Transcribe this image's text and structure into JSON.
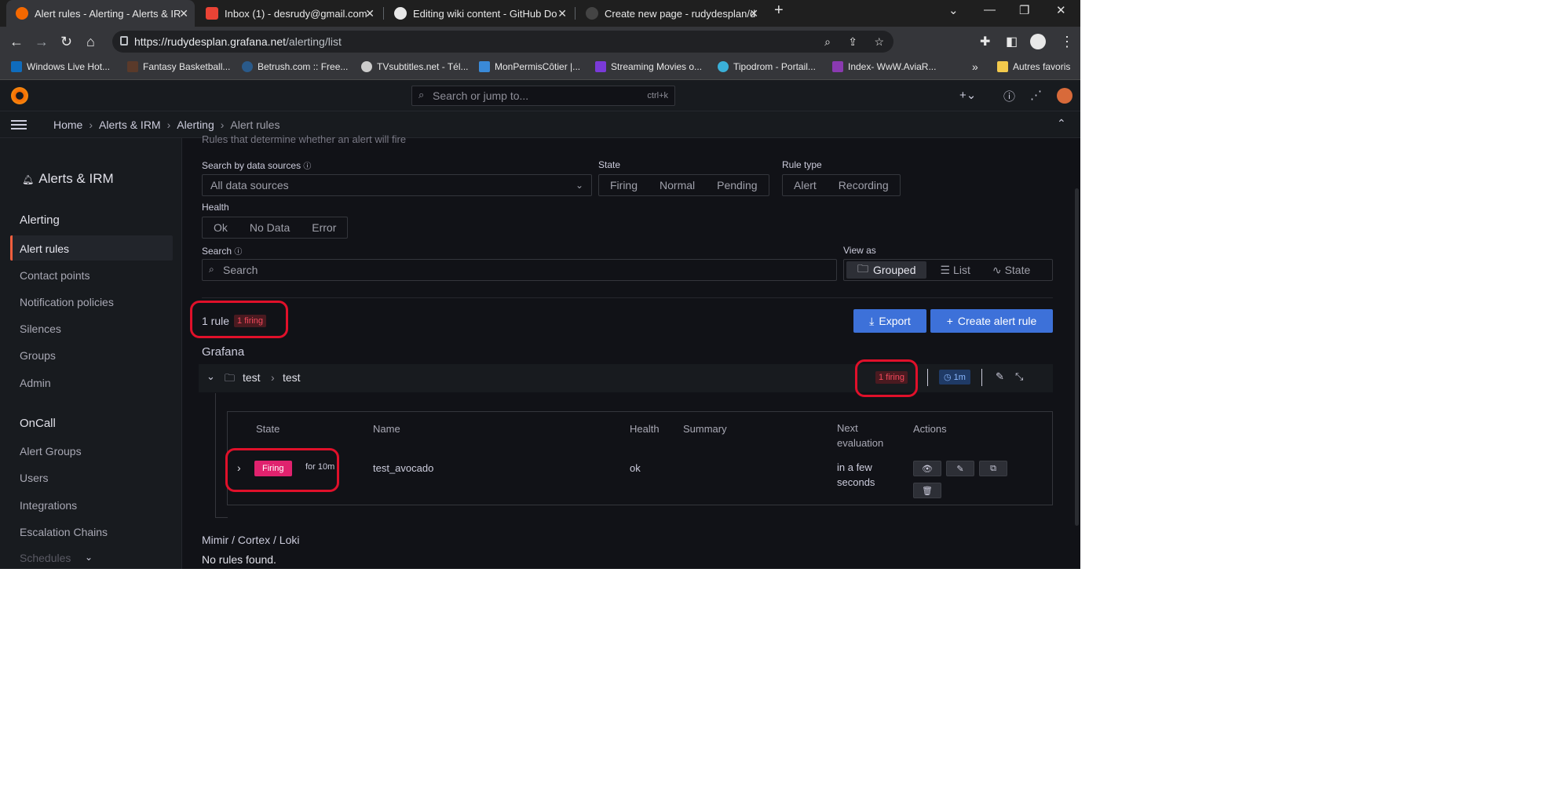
{
  "browser": {
    "tabs": [
      {
        "title": "Alert rules - Alerting - Alerts & IR",
        "active": true,
        "favicon_color": "#f46800"
      },
      {
        "title": "Inbox (1) - desrudy@gmail.com -",
        "active": false,
        "favicon_color": "#ea4335"
      },
      {
        "title": "Editing wiki content - GitHub Do",
        "active": false,
        "favicon_color": "#e8e8e8"
      },
      {
        "title": "Create new page - rudydesplan/d",
        "active": false,
        "favicon_color": "#444444"
      }
    ],
    "new_tab": "+",
    "url_host": "https://rudydesplan.grafana.net",
    "url_path": "/alerting/list",
    "bookmarks": [
      {
        "label": "Windows Live Hot...",
        "color": "#0f6cbd"
      },
      {
        "label": "Fantasy Basketball...",
        "color": "#5a3a2a"
      },
      {
        "label": "Betrush.com :: Free...",
        "color": "#2a5a8a"
      },
      {
        "label": "TVsubtitles.net - Tél...",
        "color": "#cccccc"
      },
      {
        "label": "MonPermisCôtier |...",
        "color": "#3a8ad8"
      },
      {
        "label": "Streaming Movies o...",
        "color": "#7a3ad8"
      },
      {
        "label": "Tipodrom - Portail...",
        "color": "#3ab0d8"
      },
      {
        "label": "Index- WwW.AviaR...",
        "color": "#8a3ab0"
      }
    ],
    "bookmarks_more": "»",
    "other_bookmarks": "Autres favoris"
  },
  "grafana": {
    "search_placeholder": "Search or jump to...",
    "search_shortcut": "ctrl+k",
    "breadcrumb": [
      "Home",
      "Alerts & IRM",
      "Alerting",
      "Alert rules"
    ]
  },
  "sidebar": {
    "section_title": "Alerts & IRM",
    "alerting_heading": "Alerting",
    "alerting_items": [
      "Alert rules",
      "Contact points",
      "Notification policies",
      "Silences",
      "Groups",
      "Admin"
    ],
    "oncall_heading": "OnCall",
    "oncall_items": [
      "Alert Groups",
      "Users",
      "Integrations",
      "Escalation Chains",
      "Schedules"
    ]
  },
  "main": {
    "subtitle": "Rules that determine whether an alert will fire",
    "search_by_ds_label": "Search by data sources",
    "ds_value": "All data sources",
    "state_label": "State",
    "state_options": [
      "Firing",
      "Normal",
      "Pending"
    ],
    "rule_type_label": "Rule type",
    "rule_type_options": [
      "Alert",
      "Recording"
    ],
    "health_label": "Health",
    "health_options": [
      "Ok",
      "No Data",
      "Error"
    ],
    "search_label": "Search",
    "search_placeholder": "Search",
    "view_as_label": "View as",
    "view_options": [
      "Grouped",
      "List",
      "State"
    ],
    "rule_count": "1 rule",
    "firing_count": "1 firing",
    "export_label": "Export",
    "create_label": "Create alert rule",
    "grafana_heading": "Grafana",
    "group_folder": "test",
    "group_name": "test",
    "group_firing": "1 firing",
    "group_interval": "1m",
    "table_headers": {
      "state": "State",
      "name": "Name",
      "health": "Health",
      "summary": "Summary",
      "next_eval": "Next evaluation",
      "actions": "Actions"
    },
    "row": {
      "state": "Firing",
      "duration": "for 10m",
      "name": "test_avocado",
      "health": "ok",
      "next_eval": "in a few seconds"
    },
    "mimir_heading": "Mimir / Cortex / Loki",
    "no_rules": "No rules found."
  }
}
